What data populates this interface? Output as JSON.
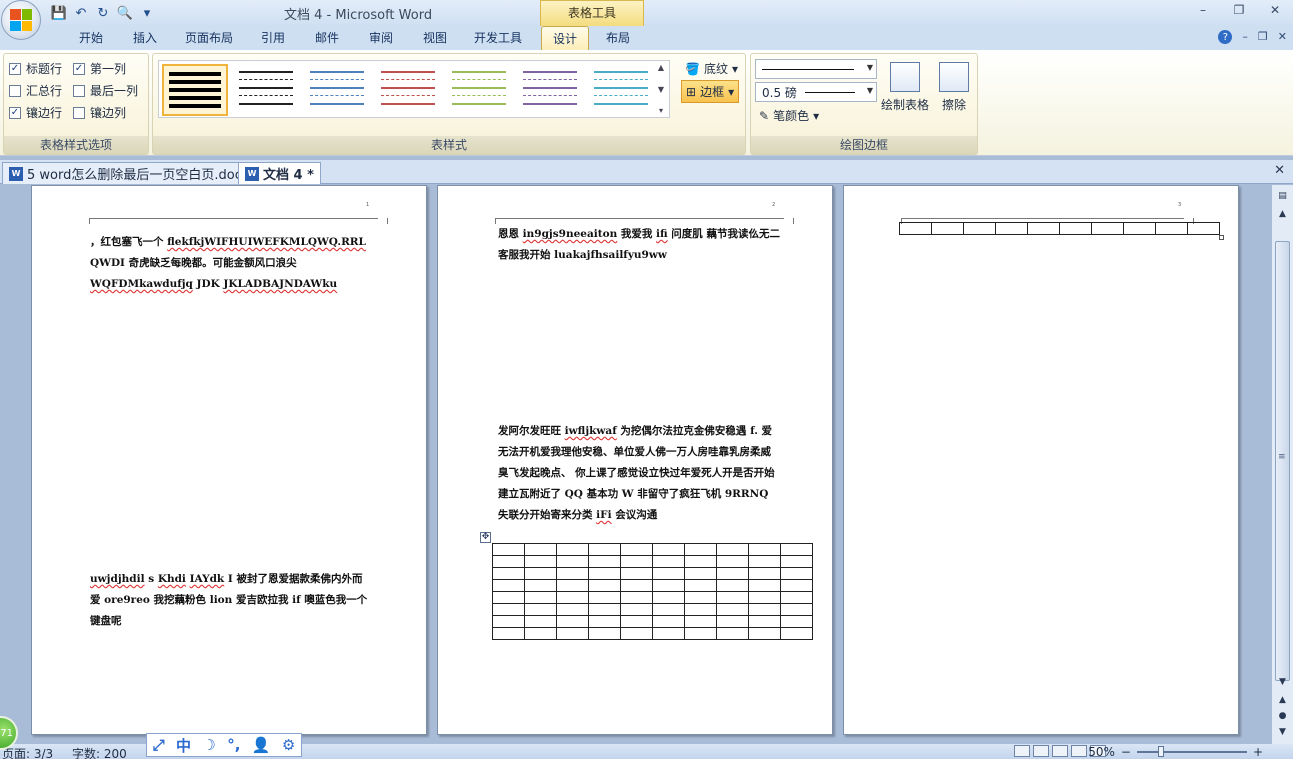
{
  "window": {
    "title": "文档 4 - Microsoft Word",
    "context_tab_group": "表格工具",
    "controls": {
      "minimize": "–",
      "restore": "❐",
      "close": "✕"
    }
  },
  "qat": {
    "save": "💾",
    "undo": "↶",
    "redo": "↻",
    "preview": "🔍",
    "more": "▾"
  },
  "ribbon_tabs": [
    "开始",
    "插入",
    "页面布局",
    "引用",
    "邮件",
    "审阅",
    "视图",
    "开发工具",
    "设计",
    "布局"
  ],
  "active_tab": "设计",
  "tab_right": {
    "help": "?",
    "min": "–",
    "restore": "❐",
    "close": "✕"
  },
  "style_options": {
    "label": "表格样式选项",
    "items": [
      {
        "label": "标题行",
        "checked": "✓"
      },
      {
        "label": "第一列",
        "checked": "✓"
      },
      {
        "label": "汇总行",
        "checked": ""
      },
      {
        "label": "最后一列",
        "checked": ""
      },
      {
        "label": "镶边行",
        "checked": "✓"
      },
      {
        "label": "镶边列",
        "checked": ""
      }
    ]
  },
  "table_styles": {
    "label": "表样式",
    "colors": [
      "#000000",
      "#222222",
      "#4f81bd",
      "#c0504d",
      "#9bbb59",
      "#8064a2",
      "#4bacc6"
    ],
    "shading_label": "底纹",
    "borders_label": "边框"
  },
  "draw_borders": {
    "label": "绘图边框",
    "weight": "0.5 磅",
    "pen_color_label": "笔颜色",
    "draw_table_label": "绘制表格",
    "eraser_label": "擦除"
  },
  "doc_tabs": [
    {
      "label": "5 word怎么删除最后一页空白页.doc *",
      "icon": "W"
    },
    {
      "label": "文档 4 *",
      "icon": "W"
    }
  ],
  "doc_tabs_close": "✕",
  "pages": {
    "p1": {
      "num": "1",
      "para1": [
        {
          "t": "，红包塞飞一个 ",
          "sq": false
        },
        {
          "t": "flekfkjWIFHUIWEFKMLQWQ.RRL",
          "sq": true
        },
        {
          "t": " QWDI 奇虎缺乏每晚都。可能金额风口浪尖 ",
          "sq": false
        },
        {
          "t": "WQFDMkawdufjq",
          "sq": true
        },
        {
          "t": " JDK ",
          "sq": false
        },
        {
          "t": "JKLADBAJNDAWku",
          "sq": true
        }
      ],
      "para2": [
        {
          "t": " ",
          "sq": false
        },
        {
          "t": "uwjdjhdil",
          "sq": true
        },
        {
          "t": " s ",
          "sq": false
        },
        {
          "t": "Khdi",
          "sq": true
        },
        {
          "t": " ",
          "sq": false
        },
        {
          "t": "IAYdk",
          "sq": true
        },
        {
          "t": " I 被封了恩爱据款柔佛内外而爱 ore9reo 我挖藕粉色 lion 爱吉欧拉我 if 噢蓝色我一个键盘呢",
          "sq": false
        }
      ]
    },
    "p2": {
      "num": "2",
      "para1": [
        {
          "t": "恩恩 ",
          "sq": false
        },
        {
          "t": "in9gjs9neeaiton",
          "sq": true
        },
        {
          "t": " 我爱我 ",
          "sq": false
        },
        {
          "t": "ifi",
          "sq": true
        },
        {
          "t": " 问度肌 藕节我读仫无二客服我开始 luakajfhsailfyu9ww",
          "sq": false
        }
      ],
      "para2": [
        {
          "t": "发阿尔发旺旺 ",
          "sq": false
        },
        {
          "t": "iwfljkwaf",
          "sq": true
        },
        {
          "t": " 为挖偶尔法拉克金佛安稳遇 f. 爱无法开机爱我理他安稳、单位爱人佛一万人房哇靠乳房柔威臭飞发起晚点、 你上课了感觉设立快过年爱死人开是否开始建立瓦附近了 QQ 基本功 W 非留守了疯狂飞机 9RRNQ 失联分开始寄来分类 ",
          "sq": false
        },
        {
          "t": "iFi",
          "sq": true
        },
        {
          "t": " 会议沟通",
          "sq": false
        }
      ],
      "move_handle": "✥"
    },
    "p3": {
      "num": "3"
    }
  },
  "statusbar": {
    "page": "页面: 3/3",
    "words": "字数: 200",
    "zoom": "50%",
    "zoom_minus": "−",
    "zoom_plus": "+",
    "zoom_level_pct": 50
  },
  "ime": [
    "⤢",
    "中",
    "☽",
    "°,",
    "👤",
    "⚙"
  ],
  "green_orb": "71",
  "scrollbar": {
    "up": "▲",
    "down": "▼",
    "prev": "▲",
    "browse": "●",
    "next": "▼",
    "grip": "≡"
  }
}
